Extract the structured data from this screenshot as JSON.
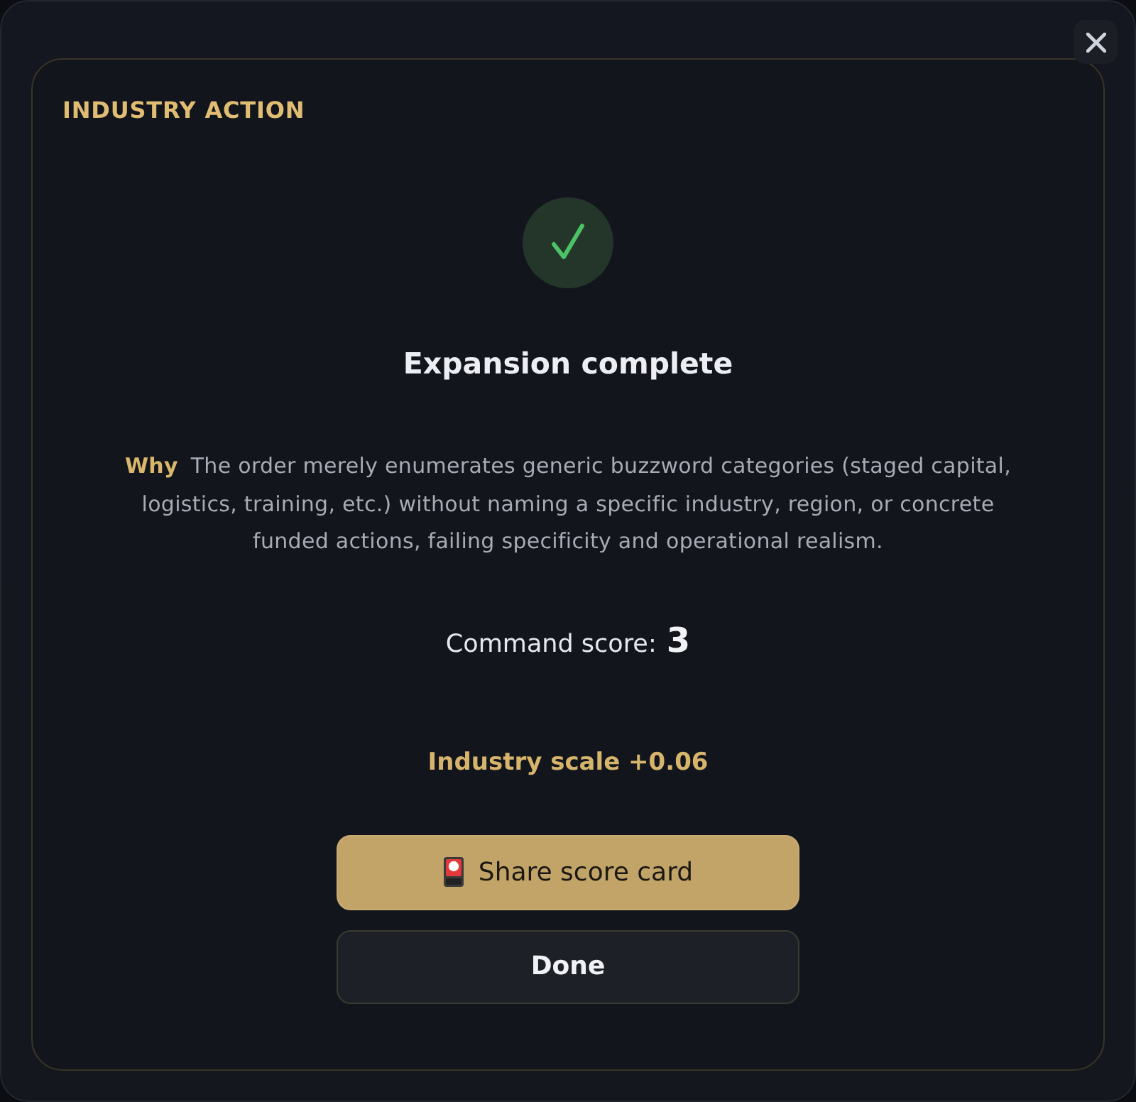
{
  "card": {
    "title": "INDUSTRY ACTION",
    "status": {
      "kind": "success",
      "heading": "Expansion complete"
    },
    "reason": "**Why** The order merely enumerates generic buzzword categories (staged capital, logistics, training, etc.) without naming a specific industry, region, or concrete funded actions, failing specificity and operational realism.",
    "score": {
      "label": "Command score:",
      "value": "3"
    },
    "effect": "Industry scale +0.06",
    "buttons": [
      {
        "kind": "primary",
        "label": "Share score card"
      },
      {
        "kind": "secondary",
        "label": "Done"
      }
    ]
  }
}
